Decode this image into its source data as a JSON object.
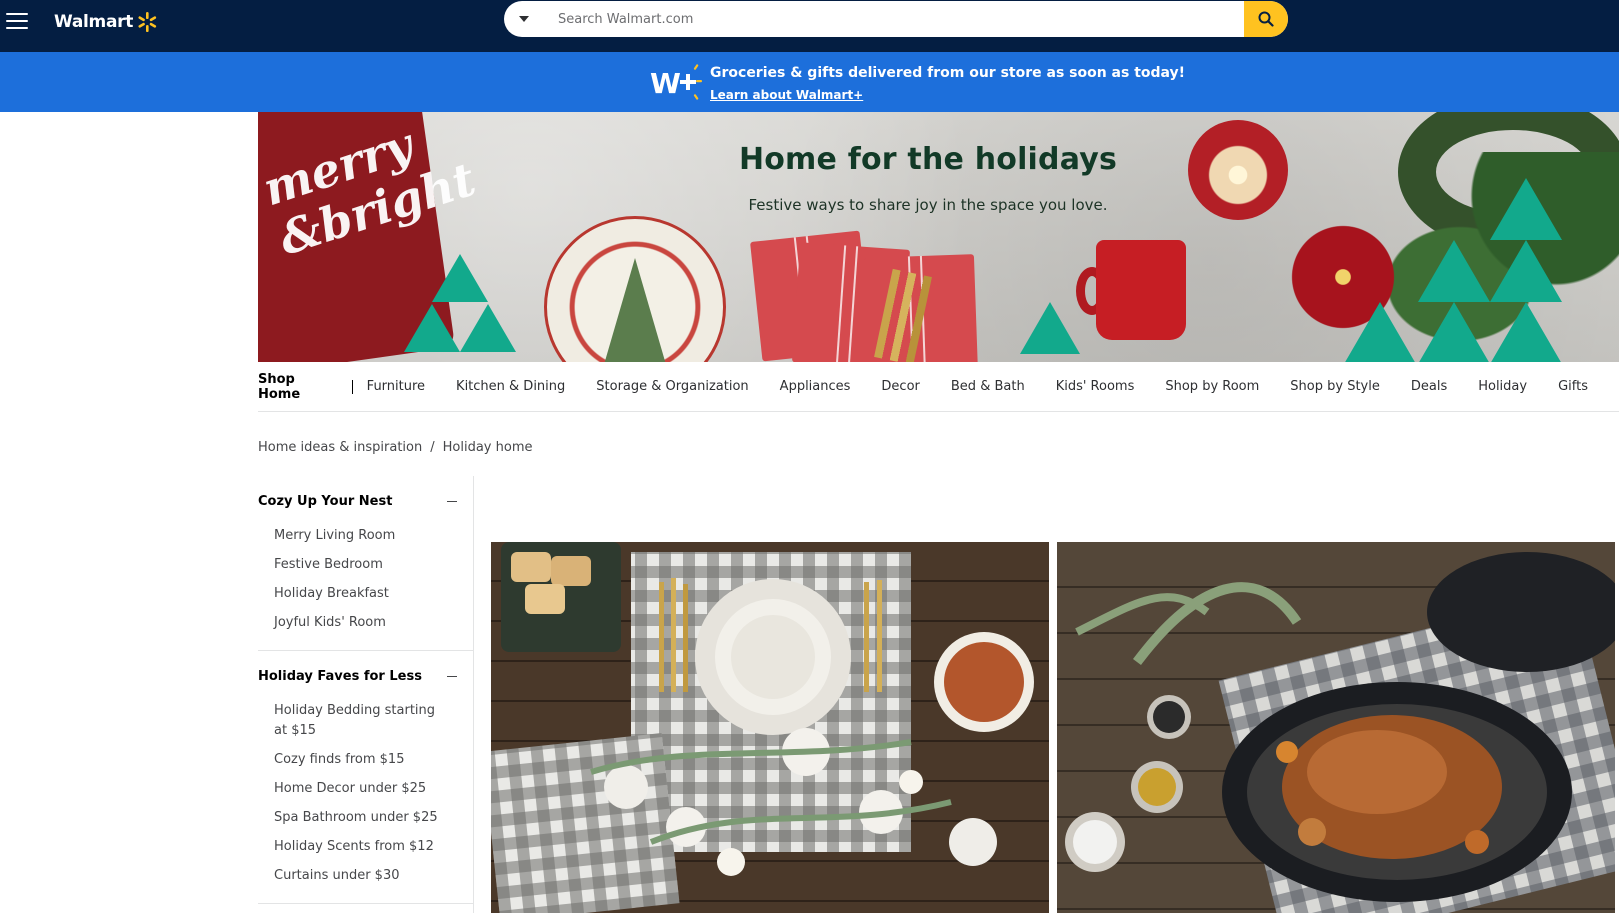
{
  "header": {
    "logo_text": "Walmart",
    "search_placeholder": "Search Walmart.com",
    "brand_blue": "#041e42",
    "accent_yellow": "#ffc220"
  },
  "plus_banner": {
    "message": "Groceries & gifts delivered from our store as soon as today!",
    "link_text": "Learn about Walmart+",
    "background": "#1d6fdb"
  },
  "hero": {
    "title": "Home for the holidays",
    "subtitle": "Festive ways to share joy in the space you love.",
    "pillow_text": "merry and bright"
  },
  "category_nav": {
    "home_label": "Shop Home",
    "items": [
      "Furniture",
      "Kitchen & Dining",
      "Storage & Organization",
      "Appliances",
      "Decor",
      "Bed & Bath",
      "Kids' Rooms",
      "Shop by Room",
      "Shop by Style",
      "Deals",
      "Holiday",
      "Gifts"
    ]
  },
  "breadcrumb": {
    "items": [
      "Home ideas & inspiration",
      "Holiday home"
    ],
    "separator": "/"
  },
  "sidebar": {
    "sections": [
      {
        "title": "Cozy Up Your Nest",
        "items": [
          "Merry Living Room",
          "Festive Bedroom",
          "Holiday Breakfast",
          "Joyful Kids' Room"
        ]
      },
      {
        "title": "Holiday Faves for Less",
        "items": [
          "Holiday Bedding starting at $15",
          "Cozy finds from $15",
          "Home Decor under $25",
          "Spa Bathroom under $25",
          "Holiday Scents from $12",
          "Curtains under $30"
        ]
      }
    ]
  }
}
